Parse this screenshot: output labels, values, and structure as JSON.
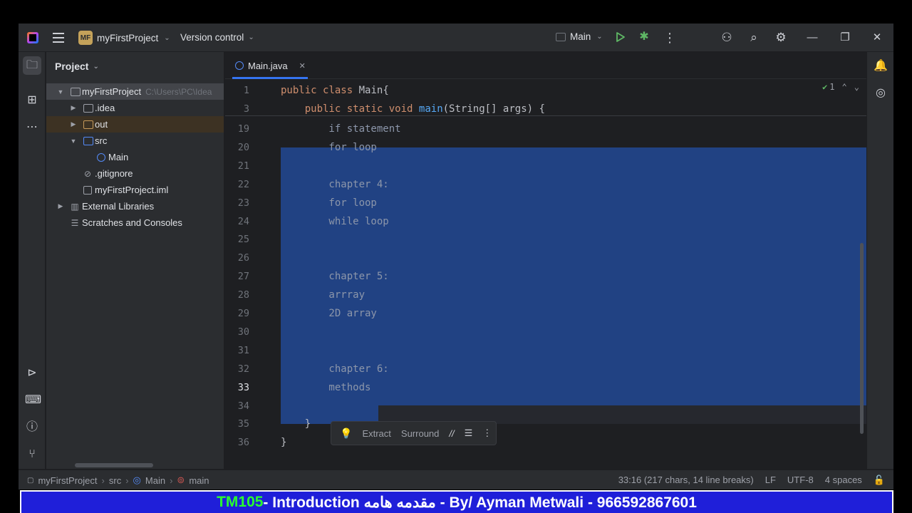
{
  "titlebar": {
    "project_badge": "MF",
    "project_name": "myFirstProject",
    "vcs_label": "Version control",
    "run_config": "Main"
  },
  "project_panel": {
    "title": "Project",
    "tree": [
      {
        "label": "myFirstProject",
        "path": "C:\\Users\\PC\\Idea"
      },
      {
        "label": ".idea"
      },
      {
        "label": "out"
      },
      {
        "label": "src"
      },
      {
        "label": "Main"
      },
      {
        "label": ".gitignore"
      },
      {
        "label": "myFirstProject.iml"
      },
      {
        "label": "External Libraries"
      },
      {
        "label": "Scratches and Consoles"
      }
    ]
  },
  "editor": {
    "tab_label": "Main.java",
    "inspections": "1",
    "lines": [
      {
        "n": "1",
        "text": "public class Main{"
      },
      {
        "n": "3",
        "text": "    public static void main(String[] args) {"
      },
      {
        "n": "19",
        "text": "        if statement"
      },
      {
        "n": "20",
        "text": "        for loop"
      },
      {
        "n": "21",
        "text": ""
      },
      {
        "n": "22",
        "text": "        chapter 4:"
      },
      {
        "n": "23",
        "text": "        for loop"
      },
      {
        "n": "24",
        "text": "        while loop"
      },
      {
        "n": "25",
        "text": ""
      },
      {
        "n": "26",
        "text": ""
      },
      {
        "n": "27",
        "text": "        chapter 5:"
      },
      {
        "n": "28",
        "text": "        arrray"
      },
      {
        "n": "29",
        "text": "        2D array"
      },
      {
        "n": "30",
        "text": ""
      },
      {
        "n": "31",
        "text": ""
      },
      {
        "n": "32",
        "text": "        chapter 6:"
      },
      {
        "n": "33",
        "text": "        methods"
      },
      {
        "n": "34",
        "text": ""
      },
      {
        "n": "35",
        "text": "    }"
      },
      {
        "n": "36",
        "text": "}"
      }
    ],
    "popup": {
      "extract": "Extract",
      "surround": "Surround",
      "comment": "//"
    }
  },
  "statusbar": {
    "crumbs": [
      "myFirstProject",
      "src",
      "Main",
      "main"
    ],
    "position": "33:16 (217 chars, 14 line breaks)",
    "line_sep": "LF",
    "encoding": "UTF-8",
    "indent": "4 spaces"
  },
  "banner": {
    "code": "TM105",
    "rest": " - Introduction مقدمه هامه - By/ Ayman Metwali - 966592867601"
  }
}
